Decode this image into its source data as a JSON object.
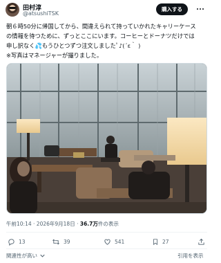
{
  "tweet": {
    "author_name": "田村淳",
    "handle": "@atsushiTSK",
    "subscribe_label": "購入する",
    "lines": [
      "朝６時50分に帰国してから、間違えられて持っていかれたキャリーケース",
      "の情報を待つために、ずっとここにいます。コーヒーとドーナツだけでは",
      "申し訳なく💦もうひとつずつ注文しましたﾟ♪(´ε｀ )",
      "※写真はマネージャーが撮りました。"
    ],
    "time": "午前10:14",
    "date": "2026年9月18日",
    "views_count": "36.7万",
    "views_label": "件の表示",
    "separator": "·"
  },
  "actions": {
    "replies": "13",
    "retweets": "39",
    "likes": "541",
    "bookmarks": "27"
  },
  "footer": {
    "left_label": "関連性が高い",
    "right_label": "引用を表示"
  },
  "colors": {
    "primary_text": "#0f1419",
    "secondary_text": "#536471",
    "button": "#0f1419"
  },
  "icons": [
    "reply-icon",
    "retweet-icon",
    "like-icon",
    "bookmark-icon",
    "share-icon",
    "more-icon",
    "chevron-down-icon"
  ]
}
